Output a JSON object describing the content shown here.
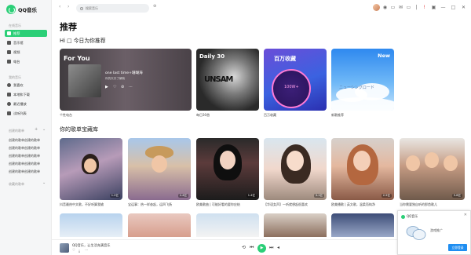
{
  "app": {
    "name": "QQ音乐"
  },
  "colors": {
    "accent": "#2bcf77",
    "popup_button": "#1f8ef1"
  },
  "sidebar": {
    "online_title": "在线音乐",
    "online": [
      {
        "label": "推荐",
        "icon": "home-icon",
        "active": true
      },
      {
        "label": "音乐馆",
        "icon": "music-hall-icon"
      },
      {
        "label": "视频",
        "icon": "video-icon"
      },
      {
        "label": "电台",
        "icon": "radio-icon"
      }
    ],
    "my_title": "我的音乐",
    "my": [
      {
        "label": "我喜欢",
        "icon": "heart-icon"
      },
      {
        "label": "本地和下载",
        "icon": "download-icon"
      },
      {
        "label": "最近播放",
        "icon": "history-icon"
      },
      {
        "label": "试听列表",
        "icon": "playlist-icon"
      }
    ],
    "created_title": "创建的歌单",
    "created": [
      "创建的歌单创建的歌单",
      "创建的歌单创建的歌单",
      "创建的歌单创建的歌单",
      "创建的歌单创建的歌单",
      "创建的歌单创建的歌单"
    ],
    "collected_title": "收藏的歌单"
  },
  "topbar": {
    "search_placeholder": "搜索音乐"
  },
  "main": {
    "title": "推荐",
    "greeting": "Hi □ 今日为你推荐",
    "recommend": [
      {
        "caption": "个性电台",
        "label": "For You",
        "song": "one last time+珊瑚海",
        "sub": "你的天天了解我"
      },
      {
        "caption": "每日30首",
        "label": "Daily 30",
        "overlay": "UNSAM"
      },
      {
        "caption": "百万收藏",
        "label": "百万收藏",
        "overlay": "100W+"
      },
      {
        "caption": "新歌推荐",
        "label": "New",
        "overlay": "ニューシングロード"
      }
    ],
    "section2": "你的歌单宝藏库",
    "playlists": [
      {
        "caption": "抖音最热中文歌，不好听算我输",
        "plays": "1.2亿"
      },
      {
        "caption": "宝运事：热一样奋起，运四飞扬",
        "plays": "2.4亿"
      },
      {
        "caption": "欧美歌曲 | 可能好看的要你应结",
        "plays": "1.4亿"
      },
      {
        "caption": "【华语女声】一听就想起很喜欢",
        "plays": "3.1亿"
      },
      {
        "caption": "欧美播歌 | 英文歌，温柔而纯净",
        "plays": "2.5亿"
      },
      {
        "caption": "当你需要独自听的那首歌儿",
        "plays": "5.6亿"
      }
    ]
  },
  "player": {
    "title": "QQ音乐，让生活充满音乐"
  },
  "popup": {
    "title": "QQ音乐",
    "text": "游戏推广",
    "button": "立即登录"
  }
}
